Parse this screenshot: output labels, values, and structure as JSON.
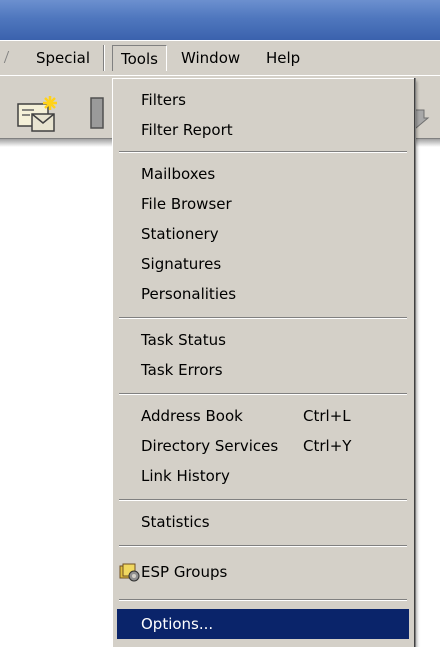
{
  "menubar": {
    "items": [
      {
        "label": "Special"
      },
      {
        "label": "Tools"
      },
      {
        "label": "Window"
      },
      {
        "label": "Help"
      }
    ],
    "active": "Tools"
  },
  "toolbar": {
    "icons": [
      "new-message-icon",
      "trash-icon",
      "arrow-icon"
    ]
  },
  "tools_menu": {
    "items": [
      {
        "label": "Filters"
      },
      {
        "label": "Filter Report"
      },
      {
        "label": "Mailboxes"
      },
      {
        "label": "File Browser"
      },
      {
        "label": "Stationery"
      },
      {
        "label": "Signatures"
      },
      {
        "label": "Personalities"
      },
      {
        "label": "Task Status"
      },
      {
        "label": "Task Errors"
      },
      {
        "label": "Address Book",
        "shortcut": "Ctrl+L"
      },
      {
        "label": "Directory Services",
        "shortcut": "Ctrl+Y"
      },
      {
        "label": "Link History"
      },
      {
        "label": "Statistics"
      },
      {
        "label": "ESP Groups",
        "icon": "esp-groups-icon"
      },
      {
        "label": "Options...",
        "selected": true
      }
    ]
  },
  "colors": {
    "menu_background": "#d4d0c8",
    "selection": "#0a246a",
    "titlebar": "#4f77be"
  }
}
